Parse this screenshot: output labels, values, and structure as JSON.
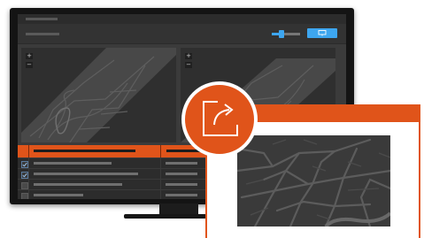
{
  "toolbar": {
    "slider_value": 0.35,
    "action_icon": "monitor-icon"
  },
  "map_controls": {
    "zoom_in": "+",
    "zoom_out": "−"
  },
  "table": {
    "rows": [
      {
        "checked": true
      },
      {
        "checked": true
      },
      {
        "checked": false
      },
      {
        "checked": false
      }
    ]
  },
  "popout": {
    "icon": "open-in-new-window-icon"
  },
  "colors": {
    "accent": "#e0541a",
    "highlight": "#3da6f0",
    "screen_bg": "#3b3b3b",
    "pane_bg": "#2f2f2f"
  }
}
